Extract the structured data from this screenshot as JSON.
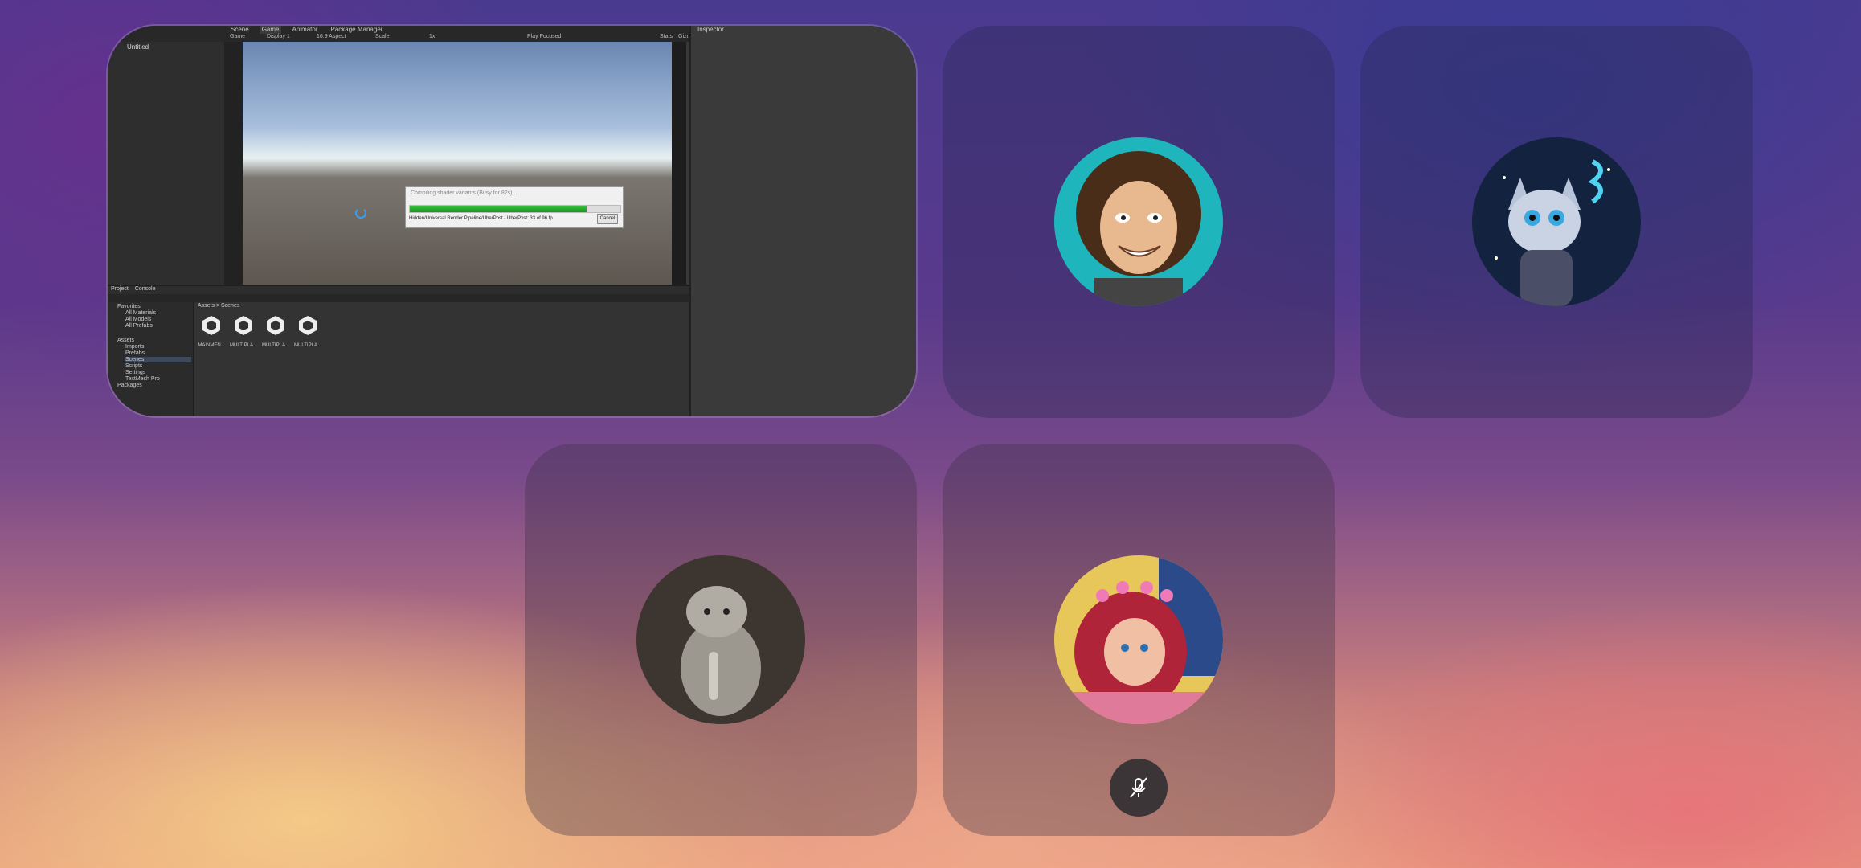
{
  "unity": {
    "tabs": [
      "Scene",
      "Game",
      "Animator",
      "Package Manager"
    ],
    "gamebar": {
      "mode": "Game",
      "display": "Display 1",
      "aspect": "16:9 Aspect",
      "scale_label": "Scale",
      "scale_value": "1x",
      "play_focused": "Play Focused",
      "stats": "Stats",
      "gizmos": "Gizmos"
    },
    "hierarchy_item": "Untitled",
    "inspector_title": "Inspector",
    "dialog": {
      "title": "Compiling shader variants (Busy for 82s)...",
      "info": "Hidden/Universal Render Pipeline/UberPost - UberPost: 33 of 96 fp",
      "cancel": "Cancel",
      "progress": 0.84
    },
    "bottom_tabs": [
      "Project",
      "Console"
    ],
    "tree": {
      "favorites": "Favorites",
      "fav_items": [
        "All Materials",
        "All Models",
        "All Prefabs"
      ],
      "assets": "Assets",
      "asset_folders": [
        "Imports",
        "Prefabs",
        "Scenes",
        "Scripts",
        "Settings",
        "TextMesh Pro"
      ],
      "packages": "Packages"
    },
    "breadcrumb": "Assets > Scenes",
    "scene_assets": [
      "MAINMEN...",
      "MULTIPLA...",
      "MULTIPLA...",
      "MULTIPLA..."
    ]
  },
  "participants": [
    {
      "name": "curly-hair-man-avatar",
      "icon": "avatar-man"
    },
    {
      "name": "cat-wizard-avatar",
      "icon": "avatar-cat-wizard"
    },
    {
      "name": "kitten-avatar",
      "icon": "avatar-kitten"
    },
    {
      "name": "ariel-avatar",
      "icon": "avatar-ariel",
      "muted": true
    }
  ],
  "colors": {
    "progress": "#22a82a",
    "tile": "#3a3a78"
  }
}
